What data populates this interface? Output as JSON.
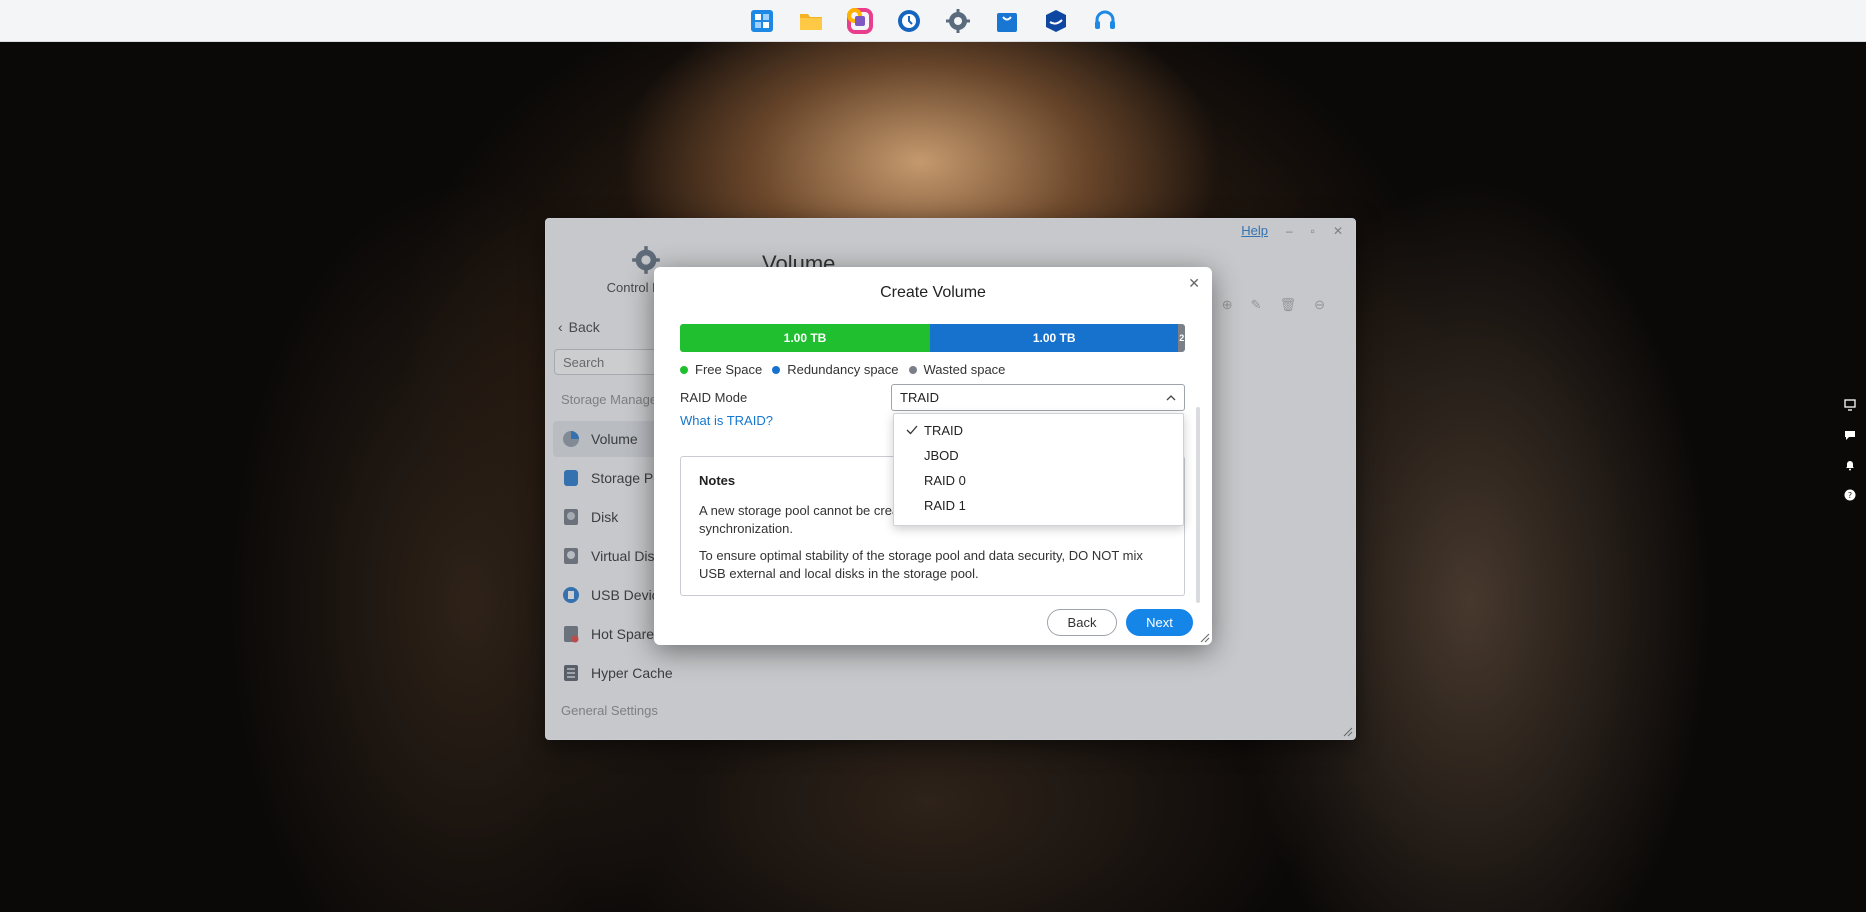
{
  "taskbar": {
    "apps": [
      {
        "icon": "app-center-icon",
        "color": "#1e88e5"
      },
      {
        "icon": "file-manager-icon",
        "color": "#f5b324"
      },
      {
        "icon": "photos-icon",
        "color": "#e83e8c"
      },
      {
        "icon": "backup-icon",
        "color": "#1565c0"
      },
      {
        "icon": "control-panel-icon",
        "color": "#5a6b7d"
      },
      {
        "icon": "store-icon",
        "color": "#1976d2"
      },
      {
        "icon": "docker-icon",
        "color": "#0d47a1"
      },
      {
        "icon": "support-icon",
        "color": "#1e88e5"
      }
    ]
  },
  "control_panel": {
    "title": "Control Panel",
    "help_label": "Help",
    "back_label": "Back",
    "search_placeholder": "Search",
    "section_storage": "Storage Manager",
    "section_general": "General Settings",
    "main_title": "Volume",
    "nav_items": [
      {
        "label": "Volume",
        "icon": "volume-icon",
        "active": true
      },
      {
        "label": "Storage Pool",
        "icon": "storage-pool-icon",
        "active": false
      },
      {
        "label": "Disk",
        "icon": "disk-icon",
        "active": false
      },
      {
        "label": "Virtual Disk",
        "icon": "virtual-disk-icon",
        "active": false
      },
      {
        "label": "USB Device",
        "icon": "usb-device-icon",
        "active": false
      },
      {
        "label": "Hot Spare",
        "icon": "hot-spare-icon",
        "active": false
      },
      {
        "label": "Hyper Cache",
        "icon": "hyper-cache-icon",
        "active": false
      }
    ]
  },
  "modal": {
    "title": "Create Volume",
    "capacity": {
      "free_label": "1.00 TB",
      "redundant_label": "1.00 TB",
      "wasted_label": "2"
    },
    "legend": {
      "free": "Free Space",
      "redundant": "Redundancy space",
      "wasted": "Wasted space"
    },
    "raid_mode_label": "RAID Mode",
    "raid_mode_value": "TRAID",
    "what_is_link": "What is TRAID?",
    "raid_options": [
      "TRAID",
      "JBOD",
      "RAID 0",
      "RAID 1"
    ],
    "selected_option": "TRAID",
    "notes": {
      "title": "Notes",
      "line1": "A new storage pool cannot be created during synchronization.",
      "line1_visible": "A new storage pool cannot be crea",
      "line1_wrap": "synchronization.",
      "line2": "To ensure optimal stability of the storage pool and data security, DO NOT mix USB external and local disks in the storage pool."
    },
    "back_button": "Back",
    "next_button": "Next"
  },
  "colors": {
    "free": "#1fbf2f",
    "redundant": "#1672cc",
    "wasted": "#7b8088",
    "accent": "#1585e8"
  }
}
